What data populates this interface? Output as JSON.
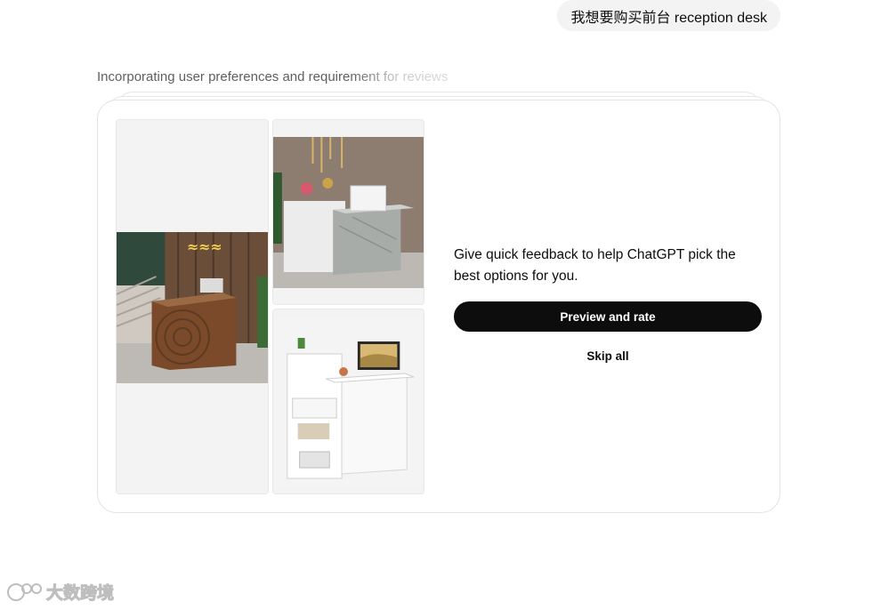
{
  "user_message": {
    "text": "我想要购买前台 reception desk"
  },
  "assistant": {
    "status_text": "Incorporating user preferences and requirement for reviews"
  },
  "feedback_card": {
    "images": [
      {
        "name": "wood-reception-desk-image",
        "alt": "Wooden reception desk"
      },
      {
        "name": "marble-white-reception-desk-image",
        "alt": "White and marble reception desk"
      },
      {
        "name": "white-shelf-reception-desk-image",
        "alt": "White reception desk with shelves"
      }
    ],
    "prompt_text": "Give quick feedback to help ChatGPT pick the best options for you.",
    "preview_button_label": "Preview and rate",
    "skip_button_label": "Skip all"
  },
  "watermark": {
    "text": "大数跨境"
  },
  "colors": {
    "bubble_bg": "#f3f3f3",
    "primary_button_bg": "#0d0d0d",
    "card_border": "#e3e3e3",
    "tile_bg": "#f3f3f3"
  }
}
